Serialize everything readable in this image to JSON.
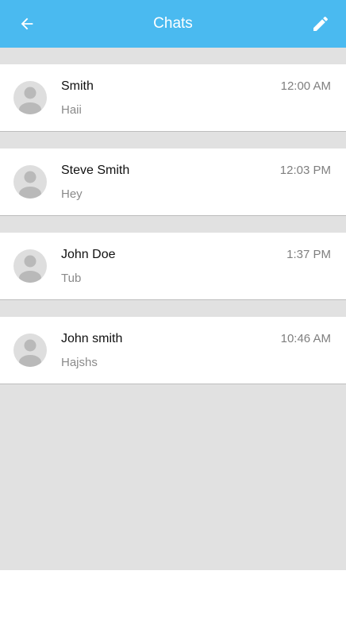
{
  "header": {
    "title": "Chats",
    "back_icon": "arrow-left-icon",
    "edit_icon": "pencil-icon",
    "background_color": "#4abaf0"
  },
  "chats": [
    {
      "name": "Smith",
      "message": "Haii",
      "time": "12:00 AM"
    },
    {
      "name": "Steve Smith",
      "message": "Hey",
      "time": "12:03 PM"
    },
    {
      "name": "John Doe",
      "message": "Tub",
      "time": "1:37 PM"
    },
    {
      "name": "John smith",
      "message": "Hajshs",
      "time": "10:46 AM"
    }
  ]
}
